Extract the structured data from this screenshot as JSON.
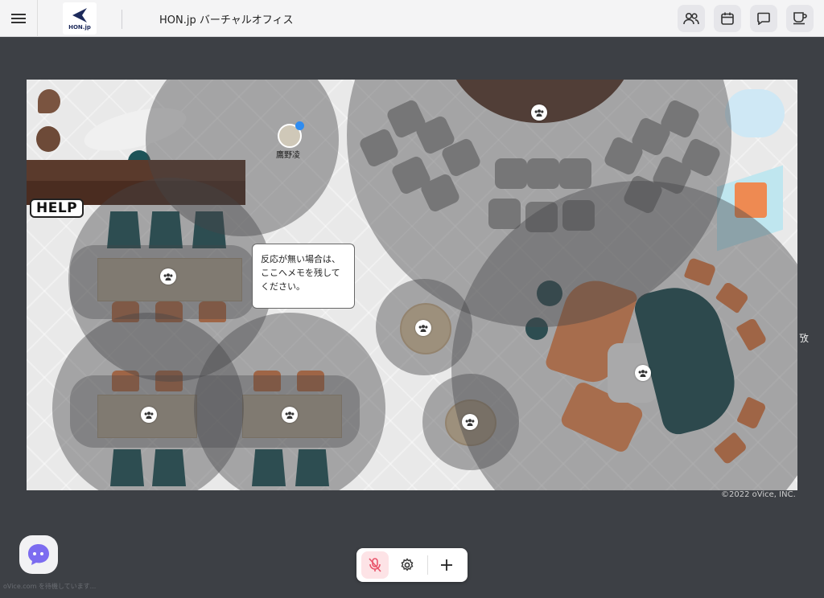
{
  "header": {
    "menu_icon": "hamburger-menu-icon",
    "logo_text": "HON.jp",
    "title": "HON.jp バーチャルオフィス",
    "buttons": [
      {
        "name": "members-button",
        "icon": "people-icon"
      },
      {
        "name": "calendar-button",
        "icon": "calendar-icon"
      },
      {
        "name": "chat-button",
        "icon": "chat-icon"
      },
      {
        "name": "coffee-break-button",
        "icon": "coffee-icon"
      }
    ]
  },
  "map": {
    "help_sign": "HELP",
    "note_text": "反応が無い場合は、ここへメモを残してください。",
    "avatar_name": "鷹野凌",
    "copyright": "©2022 oVice, INC.",
    "right_edge_label": "攷"
  },
  "controls": {
    "mic_icon": "mic-off-icon",
    "settings_icon": "gear-icon",
    "add_icon": "plus-icon"
  },
  "footer_note": "oVice.com を待機しています...",
  "colors": {
    "accent_teal": "#1d5358",
    "orange": "#e07c45",
    "mic_off": "#e9546b"
  }
}
